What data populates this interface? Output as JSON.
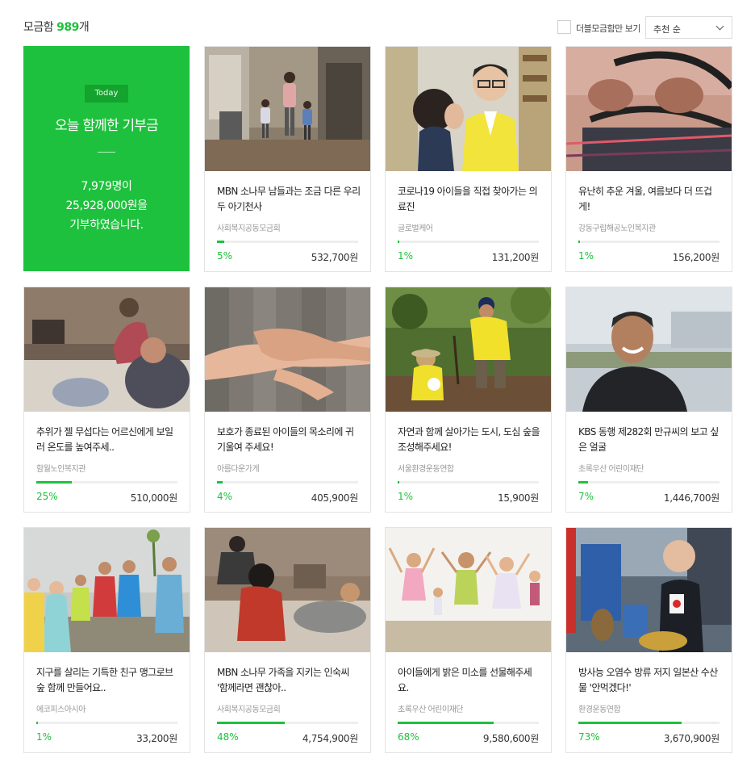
{
  "header": {
    "total_prefix": "모금함 ",
    "total_count": "989",
    "total_suffix": "개",
    "filter_label": "더블모금함만 보기",
    "sort_selected": "추천 순"
  },
  "today": {
    "badge": "Today",
    "heading": "오늘 함께한 기부금",
    "people": "7,979명이",
    "amount": "25,928,000원을",
    "closing": "기부하였습니다."
  },
  "cards": [
    {
      "title": "MBN 소나무 남들과는 조금 다른 우리 두 아기천사",
      "org": "사회복지공동모금회",
      "percent": 5,
      "percent_label": "5%",
      "amount": "532,700원",
      "photo": "children-walking-alley"
    },
    {
      "title": "코로나19 아이들을 직접 찾아가는 의료진",
      "org": "글로벌케어",
      "percent": 1,
      "percent_label": "1%",
      "amount": "131,200원",
      "photo": "doctor-examining-child"
    },
    {
      "title": "유난히 추운 겨울, 여름보다 더 뜨겁게!",
      "org": "강동구립해공노인복지관",
      "percent": 1,
      "percent_label": "1%",
      "amount": "156,200원",
      "photo": "elderly-hands-cart"
    },
    {
      "title": "추위가 젤 무섭다는 어르신에게 보일러 온도를 높여주세..",
      "org": "함월노인복지관",
      "percent": 25,
      "percent_label": "25%",
      "amount": "510,000원",
      "photo": "elderly-couple-room"
    },
    {
      "title": "보호가 종료된 아이들의 목소리에 귀 기울여 주세요!",
      "org": "아름다운가게",
      "percent": 4,
      "percent_label": "4%",
      "amount": "405,900원",
      "photo": "holding-hands"
    },
    {
      "title": "자연과 함께 살아가는 도시, 도심 숲을 조성해주세요!",
      "org": "서울환경운동연합",
      "percent": 1,
      "percent_label": "1%",
      "amount": "15,900원",
      "photo": "volunteers-planting"
    },
    {
      "title": "KBS 동행 제282회 만규씨의 보고 싶은 얼굴",
      "org": "초록우산 어린이재단",
      "percent": 7,
      "percent_label": "7%",
      "amount": "1,446,700원",
      "photo": "smiling-man-portrait"
    },
    {
      "title": "지구를 살리는 기특한 친구 맹그로브 숲 함께 만들어요..",
      "org": "에코피스아시아",
      "percent": 1,
      "percent_label": "1%",
      "amount": "33,200원",
      "photo": "group-raincoats-beach"
    },
    {
      "title": "MBN 소나무 가족을 지키는 인숙씨 '함께라면 괜찮아..",
      "org": "사회복지공동모금회",
      "percent": 48,
      "percent_label": "48%",
      "amount": "4,754,900원",
      "photo": "family-on-floor"
    },
    {
      "title": "아이들에게 밝은 미소를 선물해주세요.",
      "org": "초록우산 어린이재단",
      "percent": 68,
      "percent_label": "68%",
      "amount": "9,580,600원",
      "photo": "children-jumping"
    },
    {
      "title": "방사능 오염수 방류 저지 일본산 수산물 '안먹겠다!'",
      "org": "환경운동연합",
      "percent": 73,
      "percent_label": "73%",
      "amount": "3,670,900원",
      "photo": "protest-mask"
    }
  ],
  "colors": {
    "accent": "#1ec13d",
    "today_badge": "#14a32e",
    "track": "#eeeeee"
  }
}
